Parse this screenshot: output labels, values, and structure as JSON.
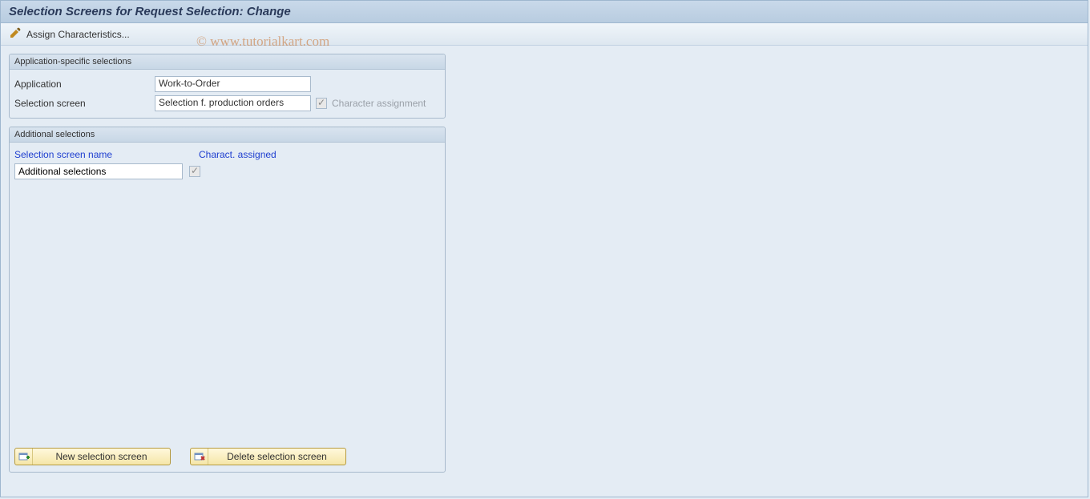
{
  "title": "Selection Screens for Request Selection: Change",
  "toolbar": {
    "assign_label": "Assign Characteristics..."
  },
  "watermark": "© www.tutorialkart.com",
  "app_group": {
    "title": "Application-specific selections",
    "application_label": "Application",
    "application_value": "Work-to-Order",
    "selection_screen_label": "Selection screen",
    "selection_screen_value": "Selection f. production orders",
    "char_assign_label": "Character assignment"
  },
  "add_group": {
    "title": "Additional selections",
    "col_name": "Selection screen name",
    "col_assigned": "Charact. assigned",
    "rows": [
      {
        "name": "Additional selections",
        "assigned": true
      }
    ],
    "new_btn": "New selection screen",
    "del_btn": "Delete selection screen"
  }
}
